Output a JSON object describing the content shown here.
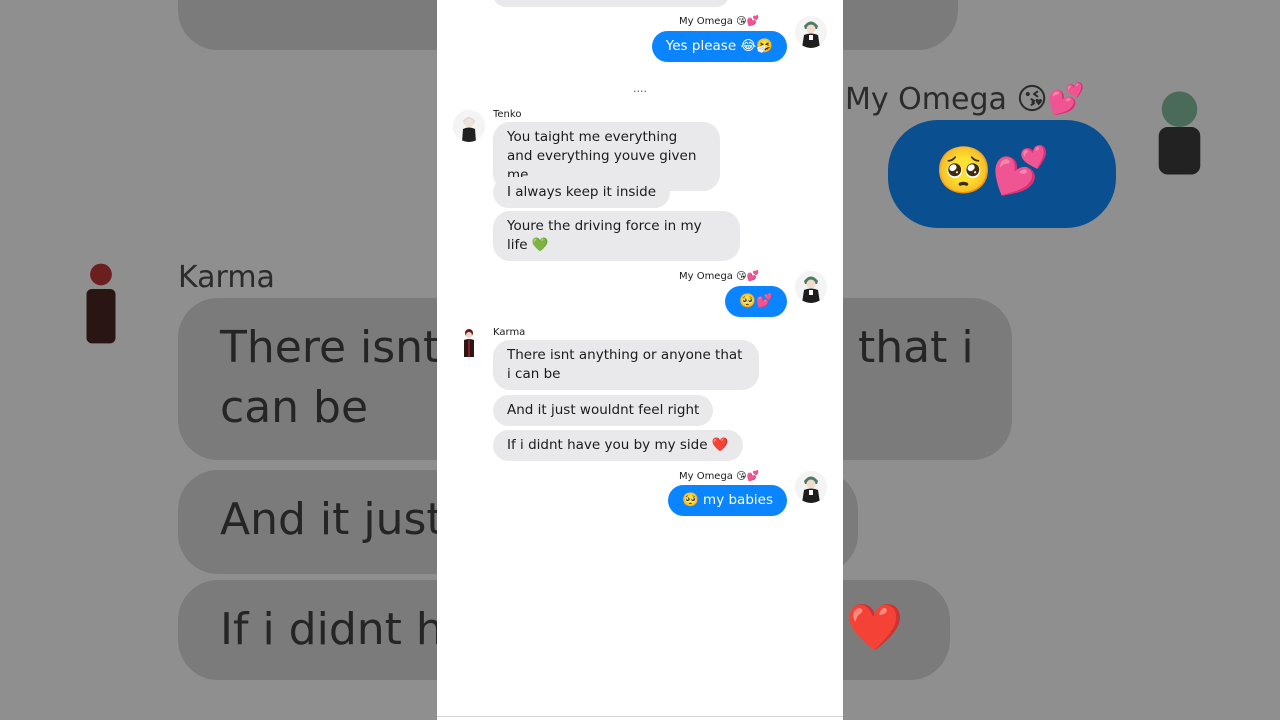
{
  "backdrop": {
    "omega_name": "My Omega 😘💕",
    "karma_name": "Karma",
    "line1": "There isnt",
    "line1_right": "that i",
    "line2": "can be",
    "line3": "And it just",
    "line4": "If i didnt ha",
    "emoji_blue": "🥺💕",
    "emoji_heart": "❤️"
  },
  "chat": {
    "top_out": {
      "name": "My Omega 😘💕",
      "text": "Yes please 😂🤧"
    },
    "separator": "....",
    "tenko": {
      "name": "Tenko",
      "messages": [
        "You taight me everything and everything youve given me",
        "I always keep it inside",
        "Youre the driving force in my life 💚"
      ]
    },
    "out2": {
      "name": "My Omega 😘💕",
      "text": "🥺💕"
    },
    "karma": {
      "name": "Karma",
      "messages": [
        "There isnt anything or anyone that i can be",
        "And it just wouldnt feel right",
        "If i didnt have you by my side ❤️"
      ]
    },
    "out3": {
      "name": "My Omega 😘💕",
      "text": "🥺 my babies"
    }
  },
  "colors": {
    "outgoing": "#0a84ff",
    "incoming": "#e9e9eb"
  },
  "icons": {
    "omega_avatar": "green-haired-avatar-icon",
    "tenko_avatar": "white-haired-avatar-icon",
    "karma_avatar": "red-haired-avatar-icon"
  }
}
